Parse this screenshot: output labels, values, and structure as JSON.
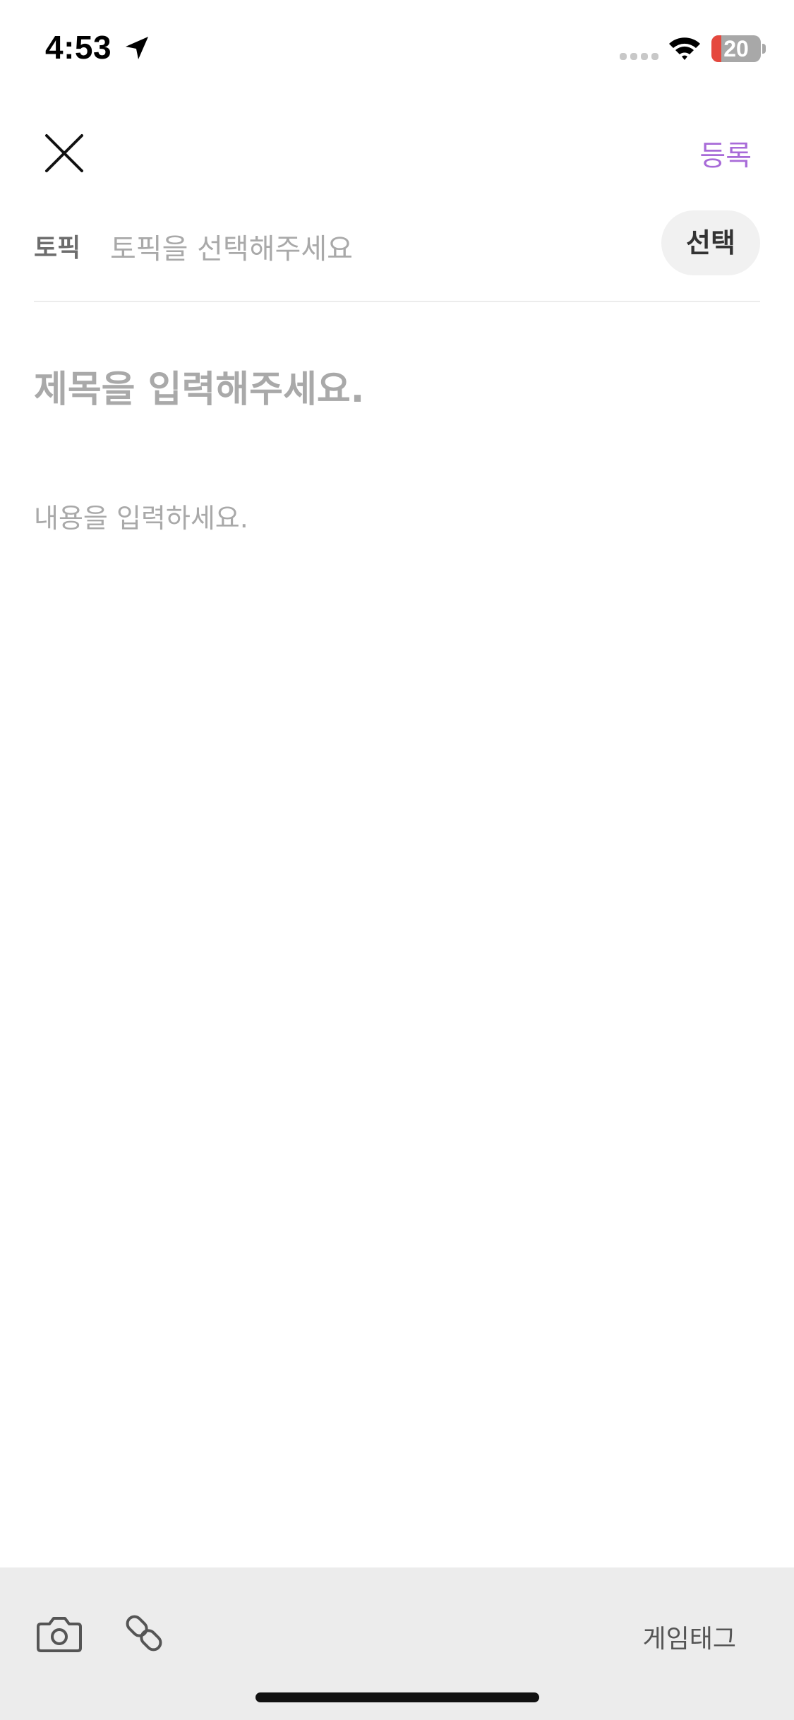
{
  "status_bar": {
    "time": "4:53",
    "battery_level": "20",
    "battery_fraction": 0.2,
    "icons": [
      "location-arrow-icon",
      "cellular-signal-icon",
      "wifi-icon",
      "battery-icon"
    ]
  },
  "header": {
    "close_icon": "close-icon",
    "submit_label": "등록"
  },
  "topic": {
    "label": "토픽",
    "placeholder": "토픽을 선택해주세요",
    "select_label": "선택"
  },
  "post": {
    "title_placeholder": "제목을 입력해주세요.",
    "title_value": "",
    "content_placeholder": "내용을 입력하세요.",
    "content_value": ""
  },
  "toolbar": {
    "camera_icon": "camera-icon",
    "link_icon": "link-icon",
    "game_tag_label": "게임태그"
  },
  "colors": {
    "accent": "#a86bd8",
    "placeholder": "#a9a9a9",
    "toolbar_bg": "#ececec",
    "battery_low": "#e5483e"
  }
}
